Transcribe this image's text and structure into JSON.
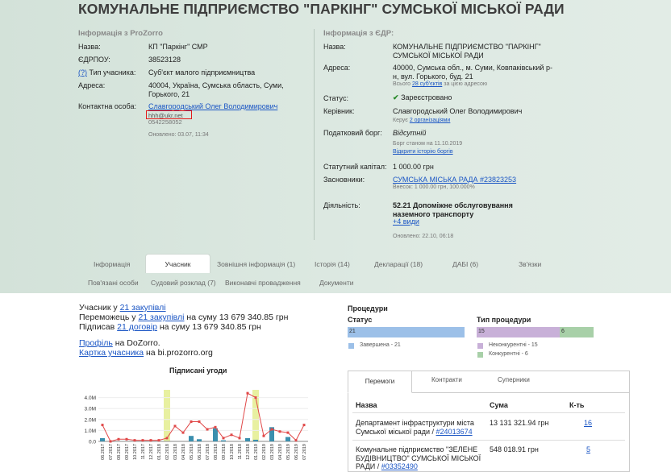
{
  "title": "КОМУНАЛЬНЕ ПІДПРИЄМСТВО \"ПАРКІНГ\" СУМСЬКОЇ МІСЬКОЇ РАДИ",
  "prozorro": {
    "heading": "Інформація з ProZorro",
    "name_label": "Назва:",
    "name_value": "КП \"Паркінг\" СМР",
    "edrpou_label": "ЄДРПОУ:",
    "edrpou_value": "38523128",
    "type_help": "(?)",
    "type_label": "Тип учасника:",
    "type_value": "Суб'єкт малого підприємництва",
    "address_label": "Адреса:",
    "address_value": "40004, Україна, Сумська область, Суми, Горького, 21",
    "contact_label": "Контактна особа:",
    "contact_name": "Славгородський Олег Володимирович",
    "contact_email": "hhh@ukr.net",
    "contact_phone": "0542258052",
    "updated": "Оновлено: 03.07, 11:34"
  },
  "edr": {
    "heading": "Інформація з ЄДР:",
    "name_label": "Назва:",
    "name_value": "КОМУНАЛЬНЕ ПІДПРИЄМСТВО \"ПАРКІНГ\" СУМСЬКОЇ МІСЬКОЇ РАДИ",
    "address_label": "Адреса:",
    "address_value": "40000, Сумська обл., м. Суми, Ковпаківський р-н, вул. Горького, буд. 21",
    "address_note_prefix": "Всього ",
    "address_note_link": "28 суб'єктів",
    "address_note_suffix": " за цією адресою",
    "status_label": "Статус:",
    "status_check": "✔",
    "status_value": "Зареєстровано",
    "head_label": "Керівник:",
    "head_value": "Славгородський Олег Володимирович",
    "head_note_prefix": "Керує ",
    "head_note_link": "2 організаціями",
    "debt_label": "Податковий борг:",
    "debt_value": "Відсутній",
    "debt_note": "Борг станом на 11.10.2019",
    "debt_history_link": "Відкрити історію боргів",
    "capital_label": "Статутний капітал:",
    "capital_value": "1 000.00 грн",
    "founders_label": "Засновники:",
    "founders_link": "СУМСЬКА МІСЬКА РАДА #23823253",
    "founders_note": "Внесок: 1 000.00 грн, 100.000%",
    "activity_label": "Діяльність:",
    "activity_value": "52.21 Допоміжне обслуговування наземного транспорту",
    "activity_more": "+4 види",
    "updated": "Оновлено: 22.10, 06:18"
  },
  "tabs_row1": [
    "Інформація",
    "Учасник",
    "Зовнішня інформація (1)",
    "Історія (14)",
    "Декларації (18)",
    "ДАБІ (6)",
    "Зв'язки"
  ],
  "tabs_row2": [
    "Пов'язані особи",
    "Судовий розклад (7)",
    "Виконавчі провадження",
    "Документи"
  ],
  "summary": {
    "line1_prefix": "Учасник у ",
    "line1_link": "21 закупівлі",
    "line2_prefix": "Переможець у ",
    "line2_link": "21 закупівлі",
    "line2_suffix": " на суму 13 679 340.85 грн",
    "line3_prefix": "Підписав ",
    "line3_link": "21 договір",
    "line3_suffix": " на суму 13 679 340.85 грн",
    "profile_link": "Профіль",
    "profile_suffix": " на DoZorro.",
    "card_link": "Картка учасника",
    "card_suffix": " на bi.prozorro.org"
  },
  "chart_data": {
    "type": "bar",
    "title": "Підписані угоди",
    "ylabel": "",
    "ylim": [
      0,
      5
    ],
    "yticks": [
      "0.0",
      "1.0M",
      "2.0M",
      "3.0M",
      "4.0M"
    ],
    "categories": [
      "06.2017",
      "07.2017",
      "08.2017",
      "09.2017",
      "10.2017",
      "11.2017",
      "12.2017",
      "01.2018",
      "02.2018",
      "03.2018",
      "04.2018",
      "05.2018",
      "06.2018",
      "07.2018",
      "08.2018",
      "09.2018",
      "10.2018",
      "11.2018",
      "12.2018",
      "01.2019",
      "02.2019",
      "03.2019",
      "04.2019",
      "05.2019",
      "06.2019",
      "07.2019"
    ],
    "series": [
      {
        "values": [
          0.3,
          0.0,
          0.0,
          0.0,
          0.0,
          0.0,
          0.0,
          0.0,
          0.0,
          0.0,
          0.0,
          0.5,
          0.2,
          0.0,
          1.2,
          0.1,
          0.0,
          0.0,
          0.3,
          0.15,
          0.0,
          1.3,
          0.0,
          0.4,
          0.0,
          0.0
        ]
      },
      {
        "values": [
          1.5,
          0.0,
          0.2,
          0.2,
          0.1,
          0.1,
          0.1,
          0.1,
          0.3,
          1.4,
          0.8,
          1.8,
          1.8,
          1.1,
          1.3,
          0.3,
          0.6,
          0.3,
          4.4,
          4.0,
          0.5,
          1.1,
          0.9,
          0.8,
          0.1,
          1.5
        ]
      }
    ],
    "highlights": [
      "02.2018",
      "01.2019"
    ],
    "colors": {
      "bars": "#3b8fae",
      "line": "#e04848",
      "highlight": "#e8f0a0"
    }
  },
  "procedures": {
    "title": "Процедури",
    "status_title": "Статус",
    "status_bar_value": "21",
    "status_legend": "Завершена - 21",
    "type_title": "Тип процедури",
    "type_bar1_value": "15",
    "type_bar2_value": "6",
    "type_legend1": "Неконкурентні - 15",
    "type_legend2": "Конкурентні - 6",
    "colors": {
      "status": "#9cc0e8",
      "noncomp": "#c8b0d8",
      "comp": "#a8d0a8"
    }
  },
  "winners": {
    "tabs": [
      "Перемоги",
      "Контракти",
      "Суперники"
    ],
    "headers": [
      "Назва",
      "Сума",
      "К-ть"
    ],
    "rows": [
      {
        "name": "Департамент інфраструктури міста Сумської міської ради / ",
        "id": "#24013674",
        "sum": "13 131 321.94 грн",
        "count": "16"
      },
      {
        "name": "Комунальне підприємство \"ЗЕЛЕНЕ БУДІВНИЦТВО\" СУМСЬКОЇ МІСЬКОЇ РАДИ / ",
        "id": "#03352490",
        "sum": "548 018.91 грн",
        "count": "5"
      }
    ]
  }
}
